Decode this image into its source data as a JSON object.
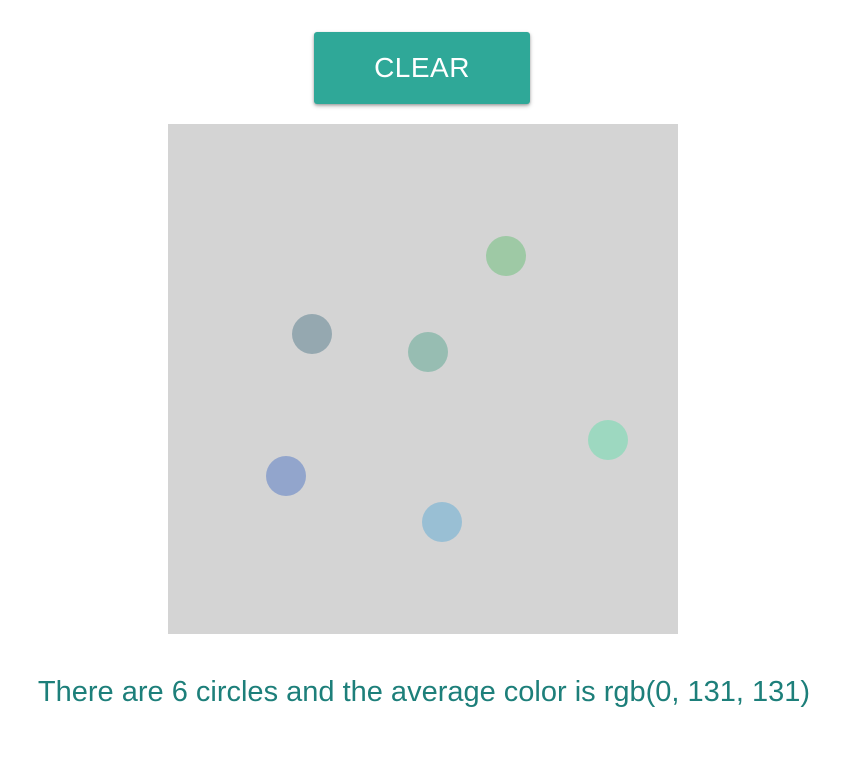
{
  "toolbar": {
    "clear_label": "CLEAR"
  },
  "canvas": {
    "background": "#d4d4d4",
    "circles": [
      {
        "color": "#9ec9a5"
      },
      {
        "color": "#95a8b0"
      },
      {
        "color": "#97bdb2"
      },
      {
        "color": "#9dd8c0"
      },
      {
        "color": "#92a5cc"
      },
      {
        "color": "#99bfd4"
      }
    ]
  },
  "status": {
    "text": "There are 6 circles and the average color is rgb(0, 131, 131)"
  },
  "colors": {
    "accent": "#2fa898",
    "status_text": "#1d7f7a"
  }
}
